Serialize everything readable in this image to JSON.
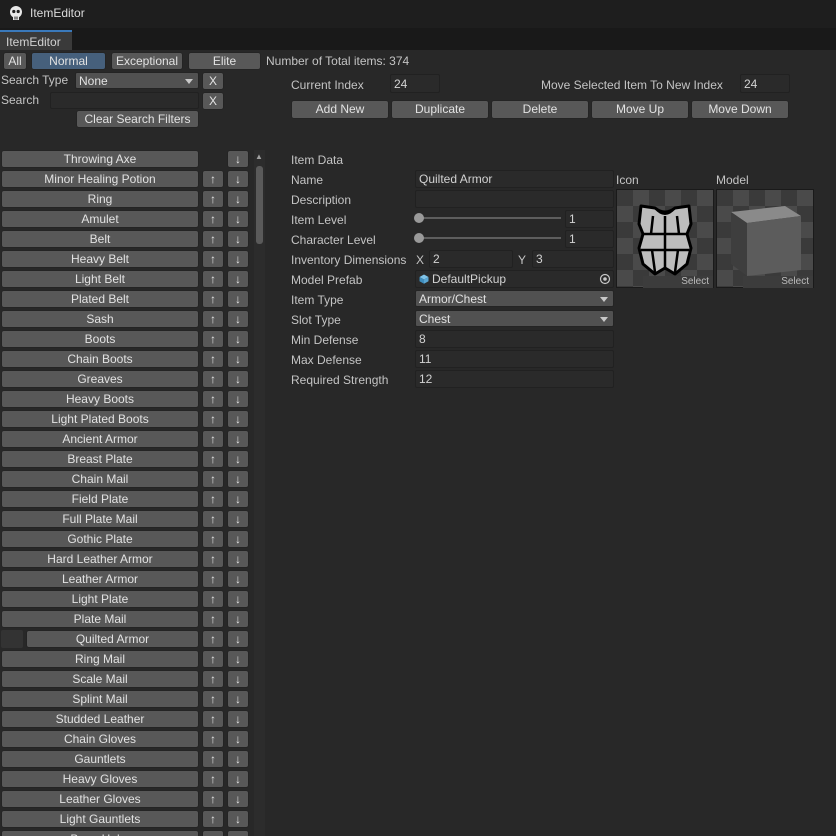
{
  "window": {
    "title": "ItemEditor",
    "tab": "ItemEditor"
  },
  "filters": {
    "buttons": [
      "All",
      "Normal",
      "Exceptional",
      "Elite"
    ],
    "selected": "Normal",
    "total_items_label": "Number of Total items: 374",
    "search_type_label": "Search Type",
    "search_type_value": "None",
    "search_label": "Search",
    "search_value": "",
    "clear_label": "X",
    "clear_filters_label": "Clear Search Filters"
  },
  "index": {
    "current_label": "Current Index",
    "current_value": "24",
    "move_label": "Move Selected Item To New Index",
    "move_value": "24"
  },
  "actions": {
    "add_new": "Add New",
    "duplicate": "Duplicate",
    "delete": "Delete",
    "move_up": "Move Up",
    "move_down": "Move Down"
  },
  "item_list": {
    "up_glyph": "↑",
    "down_glyph": "↓",
    "scroll_up_glyph": "▲",
    "selected_index": 24,
    "items": [
      "Throwing Axe",
      "Minor Healing Potion",
      "Ring",
      "Amulet",
      "Belt",
      "Heavy Belt",
      "Light Belt",
      "Plated Belt",
      "Sash",
      "Boots",
      "Chain Boots",
      "Greaves",
      "Heavy Boots",
      "Light Plated Boots",
      "Ancient Armor",
      "Breast Plate",
      "Chain Mail",
      "Field Plate",
      "Full Plate Mail",
      "Gothic Plate",
      "Hard Leather Armor",
      "Leather Armor",
      "Light Plate",
      "Plate Mail",
      "Quilted Armor",
      "Ring Mail",
      "Scale Mail",
      "Splint Mail",
      "Studded Leather",
      "Chain Gloves",
      "Gauntlets",
      "Heavy Gloves",
      "Leather Gloves",
      "Light Gauntlets",
      "Bone Helm"
    ]
  },
  "item_data": {
    "header": "Item Data",
    "name_label": "Name",
    "name_value": "Quilted Armor",
    "description_label": "Description",
    "description_value": "",
    "item_level_label": "Item Level",
    "item_level_value": "1",
    "item_level_fraction": 0.0,
    "character_level_label": "Character Level",
    "character_level_value": "1",
    "character_level_fraction": 0.0,
    "inventory_label": "Inventory Dimensions",
    "inv_x_label": "X",
    "inv_x_value": "2",
    "inv_y_label": "Y",
    "inv_y_value": "3",
    "model_prefab_label": "Model Prefab",
    "model_prefab_value": "DefaultPickup",
    "item_type_label": "Item Type",
    "item_type_value": "Armor/Chest",
    "slot_type_label": "Slot Type",
    "slot_type_value": "Chest",
    "min_defense_label": "Min Defense",
    "min_defense_value": "8",
    "max_defense_label": "Max Defense",
    "max_defense_value": "11",
    "req_strength_label": "Required Strength",
    "req_strength_value": "12"
  },
  "previews": {
    "icon_label": "Icon",
    "model_label": "Model",
    "select_label": "Select"
  },
  "colors": {
    "background": "#282828",
    "button": "#585858",
    "selected_button": "#46607c",
    "field": "#2a2a2a",
    "accent": "#3a79bb",
    "armor_collar": "#d06a1a"
  },
  "icons": [
    "unity-logo-icon",
    "chest-armor-icon",
    "cube-model-icon",
    "object-picker-icon",
    "prefab-cube-icon"
  ]
}
